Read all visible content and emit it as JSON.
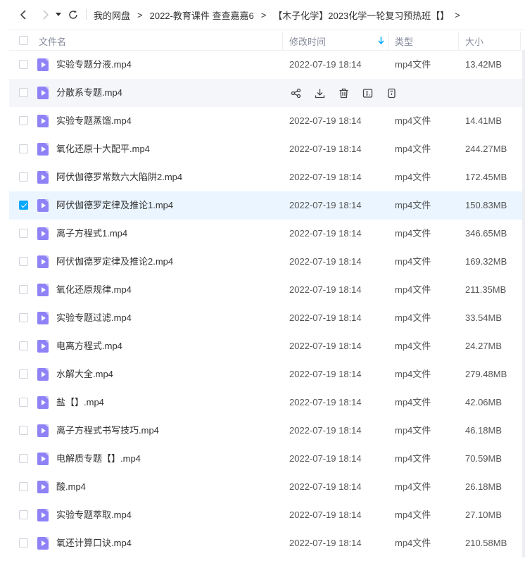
{
  "nav": {
    "back_icon": "chevron-left-icon",
    "forward_icon": "chevron-right-icon",
    "dropdown_icon": "caret-down-icon",
    "refresh_icon": "refresh-icon"
  },
  "breadcrumb": {
    "items": [
      "我的网盘",
      "2022-教育课件 查查嘉嘉6",
      "【木子化学】2023化学一轮复习预热班【】"
    ],
    "separator": ">"
  },
  "table": {
    "columns": {
      "name": "文件名",
      "time": "修改时间",
      "type": "类型",
      "size": "大小"
    },
    "sort_icon": "arrow-down-icon",
    "row_actions": [
      "share-icon",
      "download-icon",
      "delete-icon",
      "rename-icon",
      "more-icon"
    ],
    "rows": [
      {
        "name": "实验专题分液.mp4",
        "time": "2022-07-19 18:14",
        "type": "mp4文件",
        "size": "13.42MB"
      },
      {
        "name": "分散系专题.mp4",
        "time": "",
        "type": "",
        "size": ""
      },
      {
        "name": "实验专题蒸馏.mp4",
        "time": "2022-07-19 18:14",
        "type": "mp4文件",
        "size": "14.41MB"
      },
      {
        "name": "氧化还原十大配平.mp4",
        "time": "2022-07-19 18:14",
        "type": "mp4文件",
        "size": "244.27MB"
      },
      {
        "name": "阿伏伽德罗常数六大陷阱2.mp4",
        "time": "2022-07-19 18:14",
        "type": "mp4文件",
        "size": "172.45MB"
      },
      {
        "name": "阿伏伽德罗定律及推论1.mp4",
        "time": "2022-07-19 18:14",
        "type": "mp4文件",
        "size": "150.83MB"
      },
      {
        "name": "离子方程式1.mp4",
        "time": "2022-07-19 18:14",
        "type": "mp4文件",
        "size": "346.65MB"
      },
      {
        "name": "阿伏伽德罗定律及推论2.mp4",
        "time": "2022-07-19 18:14",
        "type": "mp4文件",
        "size": "169.32MB"
      },
      {
        "name": "氧化还原规律.mp4",
        "time": "2022-07-19 18:14",
        "type": "mp4文件",
        "size": "211.35MB"
      },
      {
        "name": "实验专题过滤.mp4",
        "time": "2022-07-19 18:14",
        "type": "mp4文件",
        "size": "33.54MB"
      },
      {
        "name": "电离方程式.mp4",
        "time": "2022-07-19 18:14",
        "type": "mp4文件",
        "size": "24.27MB"
      },
      {
        "name": "水解大全.mp4",
        "time": "2022-07-19 18:14",
        "type": "mp4文件",
        "size": "279.48MB"
      },
      {
        "name": "盐【】.mp4",
        "time": "2022-07-19 18:14",
        "type": "mp4文件",
        "size": "42.06MB"
      },
      {
        "name": "离子方程式书写技巧.mp4",
        "time": "2022-07-19 18:14",
        "type": "mp4文件",
        "size": "46.18MB"
      },
      {
        "name": "电解质专题【】.mp4",
        "time": "2022-07-19 18:14",
        "type": "mp4文件",
        "size": "70.59MB"
      },
      {
        "name": "酸.mp4",
        "time": "2022-07-19 18:14",
        "type": "mp4文件",
        "size": "26.18MB"
      },
      {
        "name": "实验专题萃取.mp4",
        "time": "2022-07-19 18:14",
        "type": "mp4文件",
        "size": "27.10MB"
      },
      {
        "name": "氧还计算口诀.mp4",
        "time": "2022-07-19 18:14",
        "type": "mp4文件",
        "size": "210.58MB"
      }
    ]
  },
  "state": {
    "hover_row": 1,
    "selected_row": 5
  },
  "colors": {
    "accent": "#06a7ff",
    "file_icon": "#8e82f6",
    "selected_bg": "#eaf5ff",
    "hover_bg": "#f5f6fa"
  }
}
